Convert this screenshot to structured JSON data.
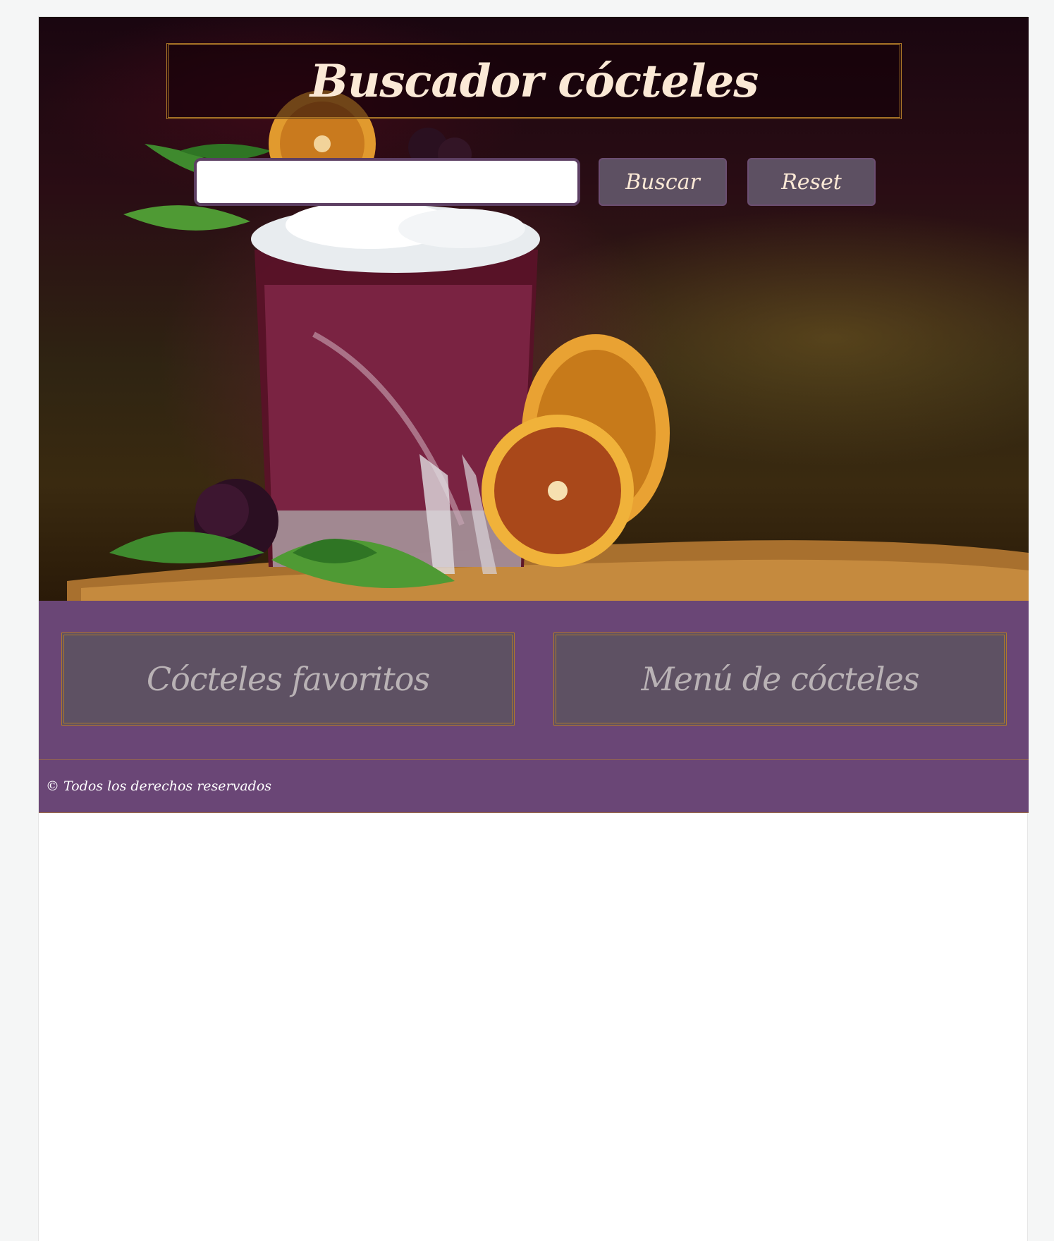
{
  "header": {
    "title": "Buscador cócteles"
  },
  "search": {
    "value": "",
    "placeholder": "",
    "buscar_label": "Buscar",
    "reset_label": "Reset"
  },
  "menu": {
    "favoritos_label": "Cócteles favoritos",
    "menu_label": "Menú de cócteles"
  },
  "footer": {
    "copyright": "© Todos los derechos reservados"
  },
  "colors": {
    "purple_band": "#6a4676",
    "card_bg": "#5e5163",
    "gold_border": "#b07a28",
    "title_text": "#fbe9d6",
    "button_bg": "#5d5062"
  },
  "hero_image": {
    "subject": "cocktail-glass-with-dried-orange-and-blackberries"
  }
}
